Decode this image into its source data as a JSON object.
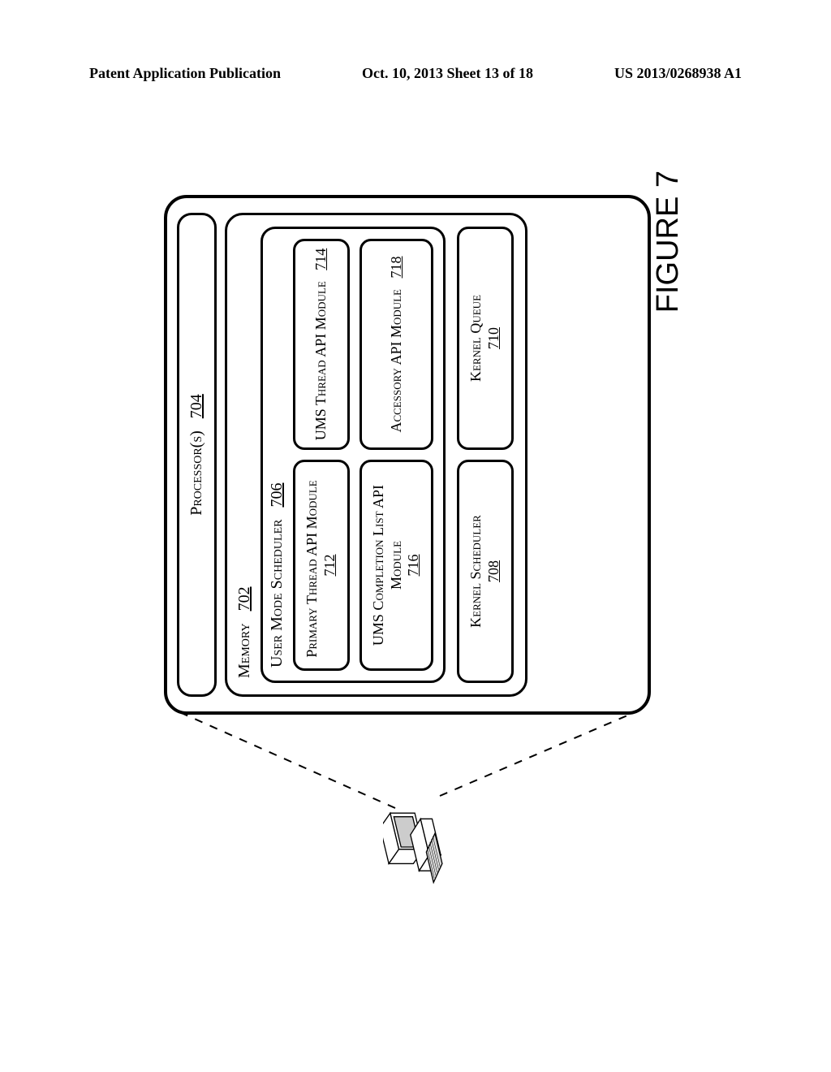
{
  "header": {
    "left": "Patent Application Publication",
    "middle": "Oct. 10, 2013  Sheet 13 of 18",
    "right": "US 2013/0268938 A1"
  },
  "figure": {
    "label": "FIGURE 7",
    "processors": {
      "label": "Processor(s)",
      "ref": "704"
    },
    "memory": {
      "label": "Memory",
      "ref": "702"
    },
    "ums": {
      "label": "User Mode Scheduler",
      "ref": "706"
    },
    "modules": {
      "primary_thread": {
        "label": "Primary Thread API Module",
        "ref": "712"
      },
      "ums_thread": {
        "label": "UMS Thread API Module",
        "ref": "714"
      },
      "ums_completion": {
        "label": "UMS Completion List API Module",
        "ref": "716"
      },
      "accessory": {
        "label": "Accessory API Module",
        "ref": "718"
      }
    },
    "kernel_scheduler": {
      "label": "Kernel Scheduler",
      "ref": "708"
    },
    "kernel_queue": {
      "label": "Kernel Queue",
      "ref": "710"
    }
  }
}
